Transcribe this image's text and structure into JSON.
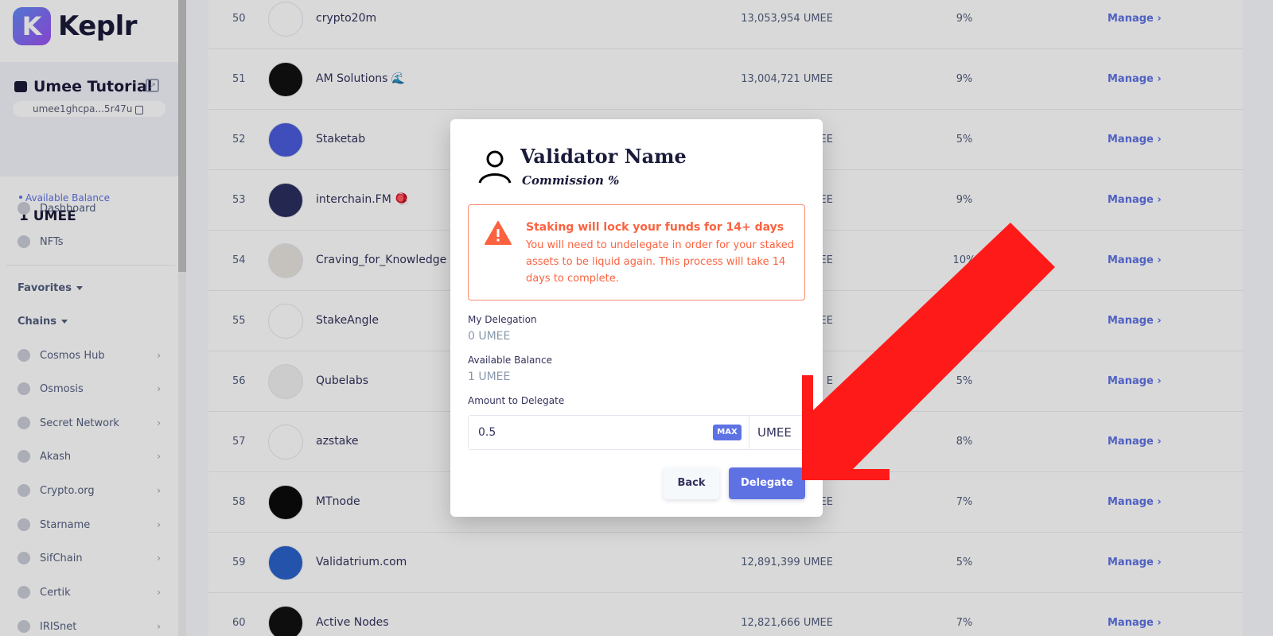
{
  "app": {
    "logo_letter": "K",
    "logo_text": "Keplr"
  },
  "account": {
    "name": "Umee Tutorial",
    "address": "umee1ghcpa...5r47u",
    "balance_label": "Available Balance",
    "balance_value": "1 UMEE"
  },
  "sidebar": {
    "top_items": [
      {
        "label": "Dashboard",
        "icon": "dashboard-icon"
      },
      {
        "label": "NFTs",
        "icon": "nft-icon"
      }
    ],
    "favorites_label": "Favorites",
    "chains_label": "Chains",
    "chains": [
      {
        "label": "Cosmos Hub",
        "icon": "cosmos-hub-icon"
      },
      {
        "label": "Osmosis",
        "icon": "osmosis-icon"
      },
      {
        "label": "Secret Network",
        "icon": "secret-network-icon"
      },
      {
        "label": "Akash",
        "icon": "akash-icon"
      },
      {
        "label": "Crypto.org",
        "icon": "crypto-org-icon"
      },
      {
        "label": "Starname",
        "icon": "starname-icon"
      },
      {
        "label": "SifChain",
        "icon": "sifchain-icon"
      },
      {
        "label": "Certik",
        "icon": "certik-icon"
      },
      {
        "label": "IRISnet",
        "icon": "irisnet-icon"
      }
    ]
  },
  "table": {
    "manage_label": "Manage",
    "rows": [
      {
        "rank": "50",
        "name": "crypto20m",
        "power": "13,053,954 UMEE",
        "commission": "9%"
      },
      {
        "rank": "51",
        "name": "AM Solutions 🌊",
        "power": "13,004,721 UMEE",
        "commission": "9%"
      },
      {
        "rank": "52",
        "name": "Staketab",
        "power": "MEE",
        "commission": "5%"
      },
      {
        "rank": "53",
        "name": "interchain.FM 🪀",
        "power": "MEE",
        "commission": "9%"
      },
      {
        "rank": "54",
        "name": "Craving_for_Knowledge",
        "power": "MEE",
        "commission": "10%"
      },
      {
        "rank": "55",
        "name": "StakeAngle",
        "power": "MEE",
        "commission": "%"
      },
      {
        "rank": "56",
        "name": "Qubelabs",
        "power": "E",
        "commission": "5%"
      },
      {
        "rank": "57",
        "name": "azstake",
        "power": "",
        "commission": "8%"
      },
      {
        "rank": "58",
        "name": "MTnode",
        "power": "MEE",
        "commission": "7%"
      },
      {
        "rank": "59",
        "name": "Validatrium.com",
        "power": "12,891,399 UMEE",
        "commission": "5%"
      },
      {
        "rank": "60",
        "name": "Active Nodes",
        "power": "12,821,666 UMEE",
        "commission": "7%"
      }
    ]
  },
  "modal": {
    "title": "Validator Name",
    "subtitle": "Commission %",
    "warning_title": "Staking will lock your funds for 14+ days",
    "warning_text": "You will need to undelegate in order for your staked assets to be liquid again. This process will take 14 days to complete.",
    "my_delegation_label": "My Delegation",
    "my_delegation_value": "0 UMEE",
    "available_balance_label": "Available Balance",
    "available_balance_value": "1 UMEE",
    "amount_label": "Amount to Delegate",
    "amount_value": "0.5",
    "max_label": "MAX",
    "denom": "UMEE",
    "back_label": "Back",
    "delegate_label": "Delegate"
  },
  "colors": {
    "accent": "#5e72e4",
    "warning": "#fb6340",
    "annotation_arrow": "#ff1a1a"
  }
}
